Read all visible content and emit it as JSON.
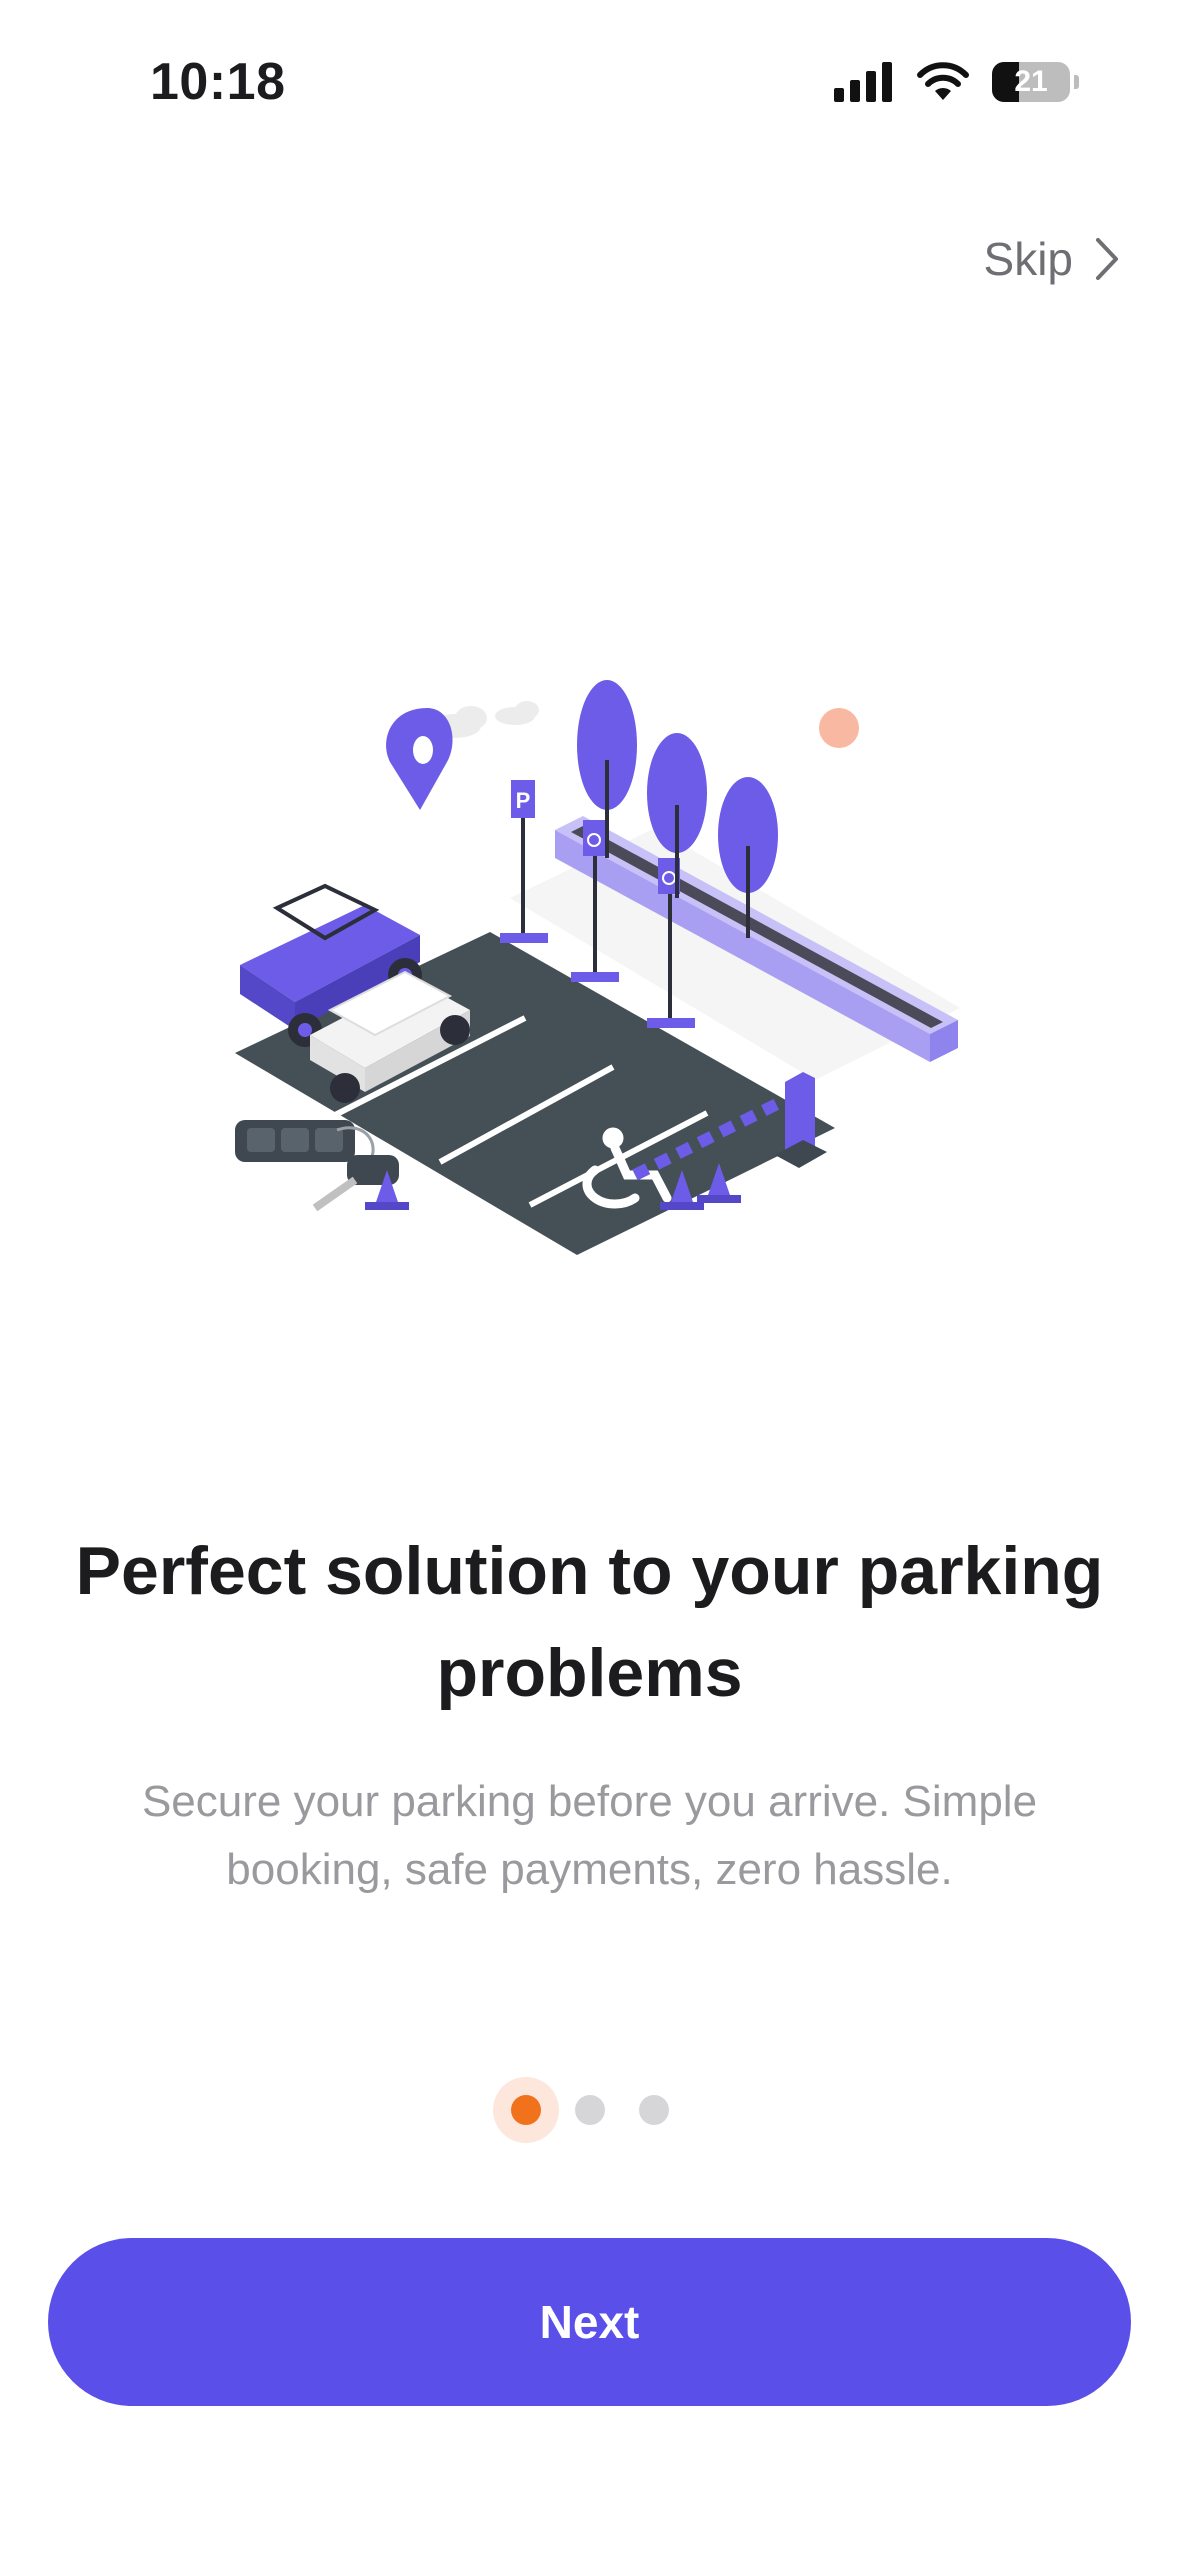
{
  "status_bar": {
    "time": "10:18",
    "battery_level": "21",
    "icons": [
      "signal-icon",
      "wifi-icon",
      "battery-icon"
    ]
  },
  "skip": {
    "label": "Skip",
    "icon": "chevron-right-icon"
  },
  "onboarding": {
    "title": "Perfect solution to your parking problems",
    "subtitle": "Secure your parking before you arrive. Simple booking, safe payments, zero hassle.",
    "page_count": 3,
    "active_page": 1
  },
  "next_button": {
    "label": "Next"
  },
  "colors": {
    "primary": "#5b4fe9",
    "accent": "#f2711c",
    "illustration_purple": "#6c5ce7",
    "asphalt": "#455056"
  }
}
